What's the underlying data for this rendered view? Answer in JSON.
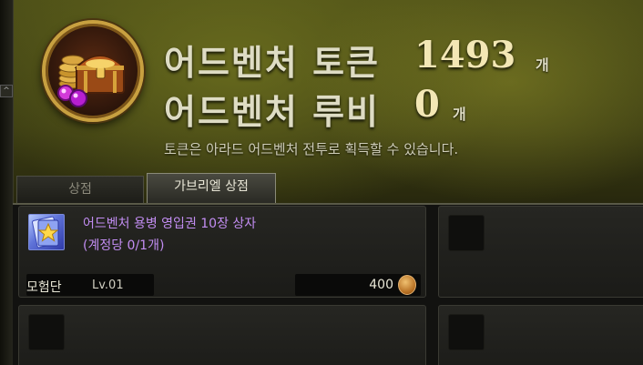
{
  "header": {
    "token_label": "어드벤처 토큰",
    "token_count": "1493",
    "token_unit": "개",
    "ruby_label": "어드벤처 루비",
    "ruby_count": "0",
    "ruby_unit": "개",
    "description": "토큰은 아라드 어드벤처 전투로 획득할 수 있습니다."
  },
  "tabs": [
    {
      "label": "상점",
      "active": false
    },
    {
      "label": "가브리엘 상점",
      "active": true
    }
  ],
  "items": [
    {
      "name": "어드벤처 용병 영입권 10장 상자",
      "limit": "(계정당 0/1개)",
      "requirement_label": "모험단",
      "requirement_level": "Lv.01",
      "price": "400",
      "currency_icon": "coin-icon",
      "icon": "card-star-icon"
    }
  ],
  "colors": {
    "item_name": "#c28df2",
    "header_text": "#dedcc4",
    "number": "#f3e7b5"
  }
}
